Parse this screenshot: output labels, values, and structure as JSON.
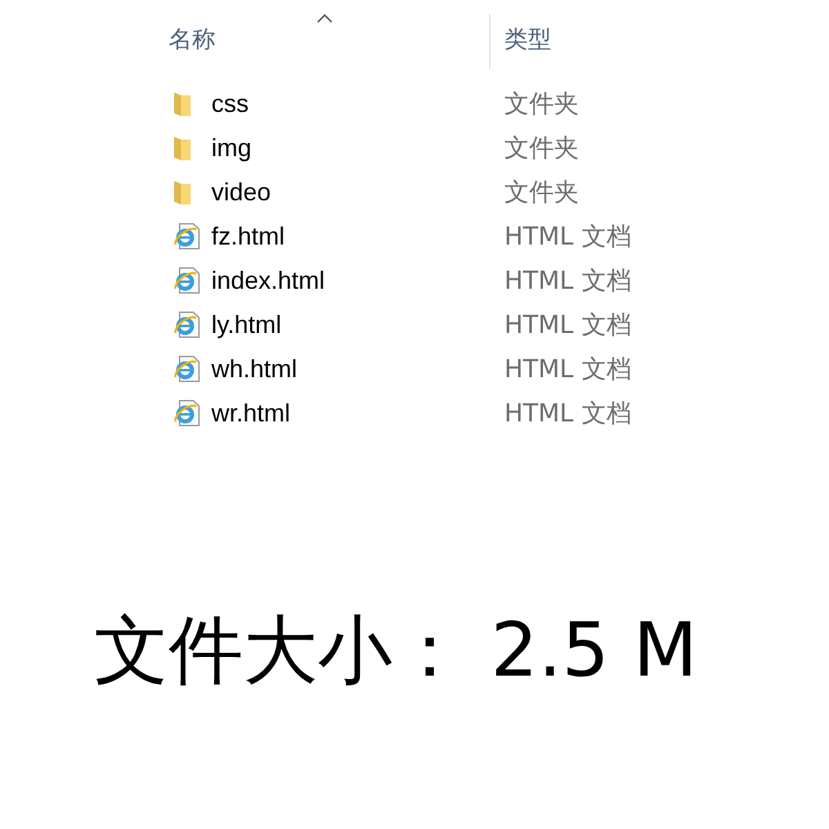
{
  "columns": [
    {
      "label": "名称",
      "sorted": true
    },
    {
      "label": "类型",
      "sorted": false
    }
  ],
  "files": [
    {
      "name": "css",
      "type": "文件夹",
      "kind": "folder"
    },
    {
      "name": "img",
      "type": "文件夹",
      "kind": "folder"
    },
    {
      "name": "video",
      "type": "文件夹",
      "kind": "folder"
    },
    {
      "name": "fz.html",
      "type": "HTML 文档",
      "kind": "html"
    },
    {
      "name": "index.html",
      "type": "HTML 文档",
      "kind": "html"
    },
    {
      "name": "ly.html",
      "type": "HTML 文档",
      "kind": "html"
    },
    {
      "name": "wh.html",
      "type": "HTML 文档",
      "kind": "html"
    },
    {
      "name": "wr.html",
      "type": "HTML 文档",
      "kind": "html"
    }
  ],
  "caption": "文件大小： 2.5 M"
}
